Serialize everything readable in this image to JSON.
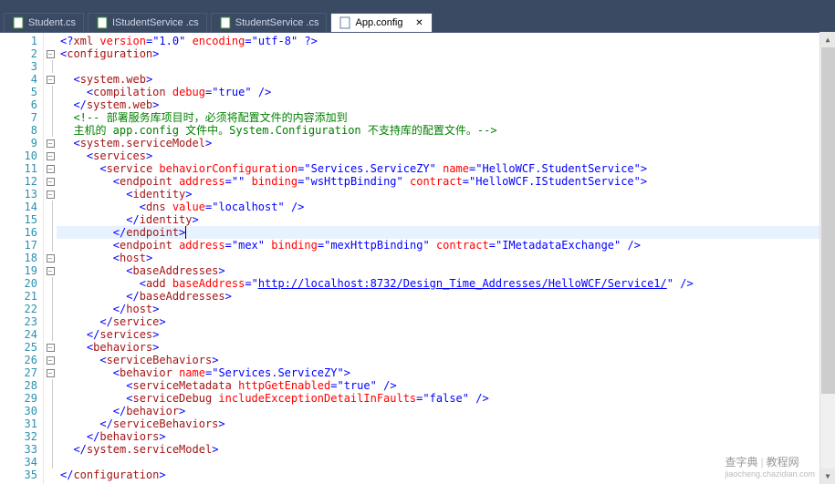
{
  "tabs": [
    {
      "label": "Student.cs",
      "icon": "cs",
      "active": false,
      "close": false
    },
    {
      "label": "IStudentService .cs",
      "icon": "cs",
      "active": false,
      "close": false
    },
    {
      "label": "StudentService .cs",
      "icon": "cs",
      "active": false,
      "close": false
    },
    {
      "label": "App.config",
      "icon": "config",
      "active": true,
      "close": true
    }
  ],
  "watermark": {
    "left": "查字典",
    "right": "教程网",
    "sub": "jiaocheng.chazidian.com"
  },
  "close_glyph": "✕",
  "code": {
    "lines": [
      {
        "n": 1,
        "fold": "",
        "h": "<span class=d>&lt;?</span><span class=t>xml</span> <span class=a>version</span><span class=d>=</span><span class=d>\"</span><span class=s>1.0</span><span class=d>\"</span> <span class=a>encoding</span><span class=d>=</span><span class=d>\"</span><span class=s>utf-8</span><span class=d>\"</span> <span class=d>?&gt;</span>"
      },
      {
        "n": 2,
        "fold": "minus",
        "h": "<span class=d>&lt;</span><span class=t>configuration</span><span class=d>&gt;</span>"
      },
      {
        "n": 3,
        "fold": "line",
        "h": ""
      },
      {
        "n": 4,
        "fold": "minus",
        "h": "  <span class=d>&lt;</span><span class=t>system.web</span><span class=d>&gt;</span>"
      },
      {
        "n": 5,
        "fold": "line",
        "h": "    <span class=d>&lt;</span><span class=t>compilation</span> <span class=a>debug</span><span class=d>=</span><span class=d>\"</span><span class=s>true</span><span class=d>\"</span> <span class=d>/&gt;</span>"
      },
      {
        "n": 6,
        "fold": "line",
        "h": "  <span class=d>&lt;/</span><span class=t>system.web</span><span class=d>&gt;</span>"
      },
      {
        "n": 7,
        "fold": "line",
        "h": "  <span class=c>&lt;!-- 部署服务库项目时，必须将配置文件的内容添加到</span>"
      },
      {
        "n": 8,
        "fold": "line",
        "h": "  <span class=c>主机的 app.config 文件中。System.Configuration 不支持库的配置文件。--&gt;</span>"
      },
      {
        "n": 9,
        "fold": "minus",
        "h": "  <span class=d>&lt;</span><span class=t>system.serviceModel</span><span class=d>&gt;</span>"
      },
      {
        "n": 10,
        "fold": "minus",
        "h": "    <span class=d>&lt;</span><span class=t>services</span><span class=d>&gt;</span>"
      },
      {
        "n": 11,
        "fold": "minus",
        "h": "      <span class=d>&lt;</span><span class=t>service</span> <span class=a>behaviorConfiguration</span><span class=d>=</span><span class=d>\"</span><span class=s>Services.ServiceZY</span><span class=d>\"</span> <span class=a>name</span><span class=d>=</span><span class=d>\"</span><span class=s>HelloWCF.StudentService</span><span class=d>\"</span><span class=d>&gt;</span>"
      },
      {
        "n": 12,
        "fold": "minus",
        "h": "        <span class=d>&lt;</span><span class=t>endpoint</span> <span class=a>address</span><span class=d>=</span><span class=d>\"\"</span> <span class=a>binding</span><span class=d>=</span><span class=d>\"</span><span class=s>wsHttpBinding</span><span class=d>\"</span> <span class=a>contract</span><span class=d>=</span><span class=d>\"</span><span class=s>HelloWCF.IStudentService</span><span class=d>\"</span><span class=d>&gt;</span>"
      },
      {
        "n": 13,
        "fold": "minus",
        "h": "          <span class=d>&lt;</span><span class=t>identity</span><span class=d>&gt;</span>"
      },
      {
        "n": 14,
        "fold": "line",
        "h": "            <span class=d>&lt;</span><span class=t>dns</span> <span class=a>value</span><span class=d>=</span><span class=d>\"</span><span class=s>localhost</span><span class=d>\"</span> <span class=d>/&gt;</span>"
      },
      {
        "n": 15,
        "fold": "line",
        "h": "          <span class=d>&lt;/</span><span class=t>identity</span><span class=d>&gt;</span>"
      },
      {
        "n": 16,
        "fold": "line",
        "h": "        <span class=d>&lt;/</span><span class=t>endpoint</span><span class=d>&gt;</span><span class=cursor></span>",
        "hl": true
      },
      {
        "n": 17,
        "fold": "line",
        "h": "        <span class=d>&lt;</span><span class=t>endpoint</span> <span class=a>address</span><span class=d>=</span><span class=d>\"</span><span class=s>mex</span><span class=d>\"</span> <span class=a>binding</span><span class=d>=</span><span class=d>\"</span><span class=s>mexHttpBinding</span><span class=d>\"</span> <span class=a>contract</span><span class=d>=</span><span class=d>\"</span><span class=s>IMetadataExchange</span><span class=d>\"</span> <span class=d>/&gt;</span>"
      },
      {
        "n": 18,
        "fold": "minus",
        "h": "        <span class=d>&lt;</span><span class=t>host</span><span class=d>&gt;</span>"
      },
      {
        "n": 19,
        "fold": "minus",
        "h": "          <span class=d>&lt;</span><span class=t>baseAddresses</span><span class=d>&gt;</span>"
      },
      {
        "n": 20,
        "fold": "line",
        "h": "            <span class=d>&lt;</span><span class=t>add</span> <span class=a>baseAddress</span><span class=d>=</span><span class=d>\"</span><span class=u>http://localhost:8732/Design_Time_Addresses/HelloWCF/Service1/</span><span class=d>\"</span> <span class=d>/&gt;</span>"
      },
      {
        "n": 21,
        "fold": "line",
        "h": "          <span class=d>&lt;/</span><span class=t>baseAddresses</span><span class=d>&gt;</span>"
      },
      {
        "n": 22,
        "fold": "line",
        "h": "        <span class=d>&lt;/</span><span class=t>host</span><span class=d>&gt;</span>"
      },
      {
        "n": 23,
        "fold": "line",
        "h": "      <span class=d>&lt;/</span><span class=t>service</span><span class=d>&gt;</span>"
      },
      {
        "n": 24,
        "fold": "line",
        "h": "    <span class=d>&lt;/</span><span class=t>services</span><span class=d>&gt;</span>"
      },
      {
        "n": 25,
        "fold": "minus",
        "h": "    <span class=d>&lt;</span><span class=t>behaviors</span><span class=d>&gt;</span>"
      },
      {
        "n": 26,
        "fold": "minus",
        "h": "      <span class=d>&lt;</span><span class=t>serviceBehaviors</span><span class=d>&gt;</span>"
      },
      {
        "n": 27,
        "fold": "minus",
        "h": "        <span class=d>&lt;</span><span class=t>behavior</span> <span class=a>name</span><span class=d>=</span><span class=d>\"</span><span class=s>Services.ServiceZY</span><span class=d>\"</span><span class=d>&gt;</span>"
      },
      {
        "n": 28,
        "fold": "line",
        "h": "          <span class=d>&lt;</span><span class=t>serviceMetadata</span> <span class=a>httpGetEnabled</span><span class=d>=</span><span class=d>\"</span><span class=s>true</span><span class=d>\"</span> <span class=d>/&gt;</span>"
      },
      {
        "n": 29,
        "fold": "line",
        "h": "          <span class=d>&lt;</span><span class=t>serviceDebug</span> <span class=a>includeExceptionDetailInFaults</span><span class=d>=</span><span class=d>\"</span><span class=s>false</span><span class=d>\"</span> <span class=d>/&gt;</span>"
      },
      {
        "n": 30,
        "fold": "line",
        "h": "        <span class=d>&lt;/</span><span class=t>behavior</span><span class=d>&gt;</span>"
      },
      {
        "n": 31,
        "fold": "line",
        "h": "      <span class=d>&lt;/</span><span class=t>serviceBehaviors</span><span class=d>&gt;</span>"
      },
      {
        "n": 32,
        "fold": "line",
        "h": "    <span class=d>&lt;/</span><span class=t>behaviors</span><span class=d>&gt;</span>"
      },
      {
        "n": 33,
        "fold": "line",
        "h": "  <span class=d>&lt;/</span><span class=t>system.serviceModel</span><span class=d>&gt;</span>"
      },
      {
        "n": 34,
        "fold": "line",
        "h": ""
      },
      {
        "n": 35,
        "fold": "",
        "h": "<span class=d>&lt;/</span><span class=t>configuration</span><span class=d>&gt;</span>"
      }
    ]
  }
}
